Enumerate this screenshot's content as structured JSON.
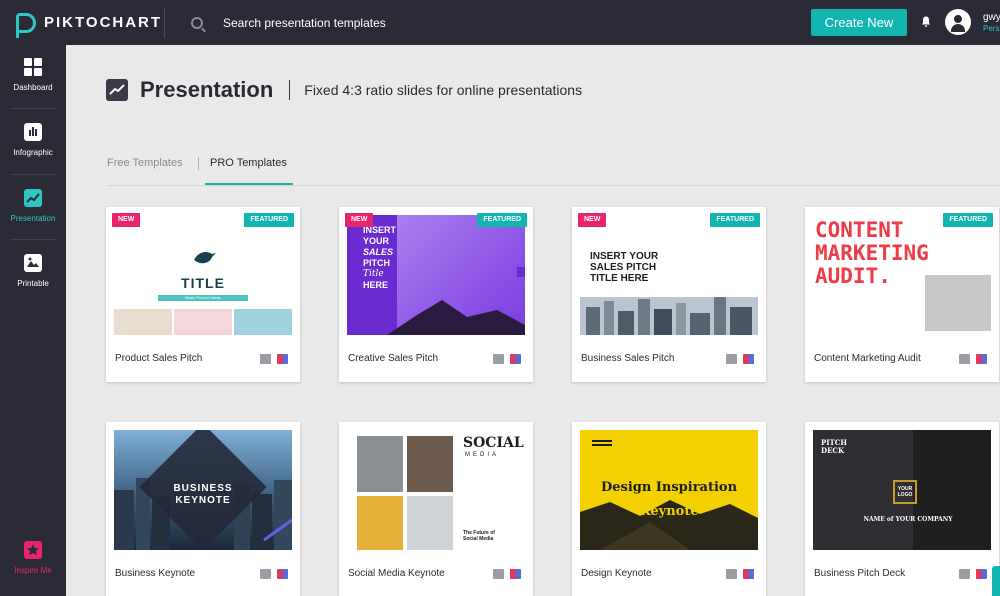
{
  "app": {
    "brand": "PIKTOCHART"
  },
  "header": {
    "search_placeholder": "Search presentation templates",
    "create_label": "Create New",
    "user_name": "gwy",
    "user_plan": "Pers"
  },
  "sidebar": {
    "items": [
      {
        "label": "Dashboard",
        "icon": "grid-icon"
      },
      {
        "label": "Infographic",
        "icon": "bar-chart-icon"
      },
      {
        "label": "Presentation",
        "icon": "trend-chart-icon"
      },
      {
        "label": "Printable",
        "icon": "image-icon"
      }
    ],
    "inspire_label": "Inspire Me"
  },
  "page": {
    "title": "Presentation",
    "subtitle": "Fixed 4:3 ratio slides for online presentations"
  },
  "tabs": {
    "free": "Free Templates",
    "pro": "PRO Templates",
    "active": "PRO Templates"
  },
  "badges": {
    "new": "NEW",
    "featured": "FEATURED"
  },
  "cards": [
    {
      "title": "Product Sales Pitch",
      "new": true,
      "featured": true,
      "thumb": {
        "heading": "TITLE",
        "sub": "Basic Product Ideas"
      }
    },
    {
      "title": "Creative Sales Pitch",
      "new": true,
      "featured": true,
      "thumb": {
        "l1": "INSERT",
        "l2": "YOUR",
        "l3": "SALES",
        "l4": "PITCH",
        "l5": "Title",
        "l6": "HERE"
      }
    },
    {
      "title": "Business Sales Pitch",
      "new": true,
      "featured": true,
      "thumb": {
        "l1": "INSERT YOUR",
        "l2": "SALES PITCH",
        "l3": "TITLE HERE"
      }
    },
    {
      "title": "Content Marketing Audit",
      "new": false,
      "featured": true,
      "thumb": {
        "l1": "CONTENT",
        "l2": "MARKETING",
        "l3": "AUDIT."
      }
    },
    {
      "title": "Business Keynote",
      "new": false,
      "featured": false,
      "thumb": {
        "l1": "BUSINESS",
        "l2": "KEYNOTE"
      }
    },
    {
      "title": "Social Media Keynote",
      "new": false,
      "featured": false,
      "thumb": {
        "l1": "SOCIAL",
        "l2": "MEDIA",
        "l3": "The Future of",
        "l4": "Social Media"
      }
    },
    {
      "title": "Design Keynote",
      "new": false,
      "featured": false,
      "thumb": {
        "l1": "Design Inspiration",
        "l2": "Keynote"
      }
    },
    {
      "title": "Business Pitch Deck",
      "new": false,
      "featured": false,
      "thumb": {
        "l1": "PITCH",
        "l2": "DECK",
        "l3": "YOUR",
        "l4": "LOGO",
        "l5": "NAME of YOUR COMPANY"
      }
    }
  ],
  "colors": {
    "accent": "#12b5b0",
    "new_badge": "#e8246c",
    "sidebar_bg": "#2b2b38",
    "inspire": "#e8246c"
  }
}
